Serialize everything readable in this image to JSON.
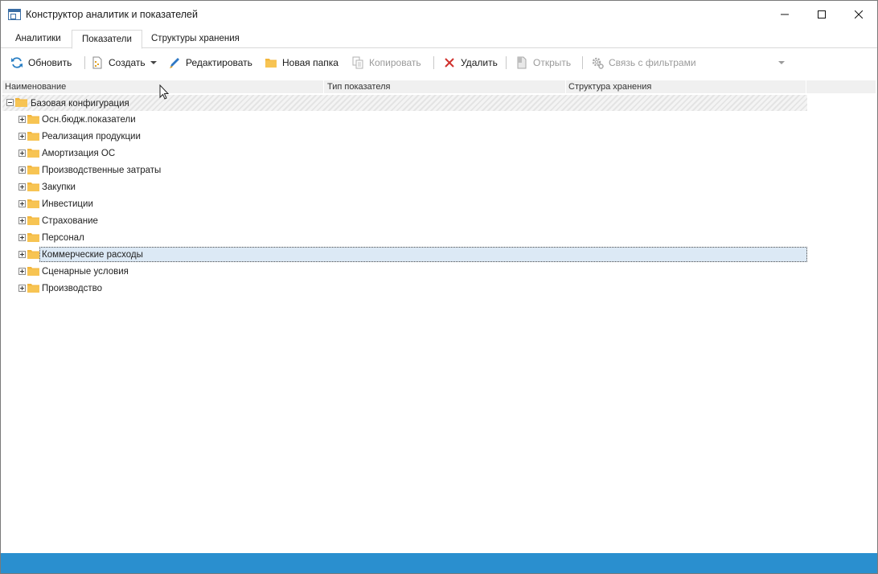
{
  "window": {
    "title": "Конструктор аналитик и показателей",
    "status_color": "#2a8fcf"
  },
  "tabs": [
    {
      "label": "Аналитики",
      "active": false
    },
    {
      "label": "Показатели",
      "active": true
    },
    {
      "label": "Структуры хранения",
      "active": false
    }
  ],
  "toolbar": {
    "refresh": "Обновить",
    "create": "Создать",
    "edit": "Редактировать",
    "new_folder": "Новая папка",
    "copy": "Копировать",
    "delete": "Удалить",
    "open": "Открыть",
    "filter_link": "Связь с фильтрами"
  },
  "grid": {
    "columns": [
      "Наименование",
      "Тип показателя",
      "Структура хранения"
    ],
    "root": {
      "label": "Базовая конфигурация",
      "expanded": true
    },
    "items": [
      {
        "label": "Осн.бюдж.показатели"
      },
      {
        "label": "Реализация продукции"
      },
      {
        "label": "Амортизация ОС"
      },
      {
        "label": "Производственные затраты"
      },
      {
        "label": "Закупки"
      },
      {
        "label": "Инвестиции"
      },
      {
        "label": "Страхование"
      },
      {
        "label": "Персонал"
      },
      {
        "label": "Коммерческие расходы",
        "selected": true
      },
      {
        "label": "Сценарные условия"
      },
      {
        "label": "Производство"
      }
    ]
  }
}
